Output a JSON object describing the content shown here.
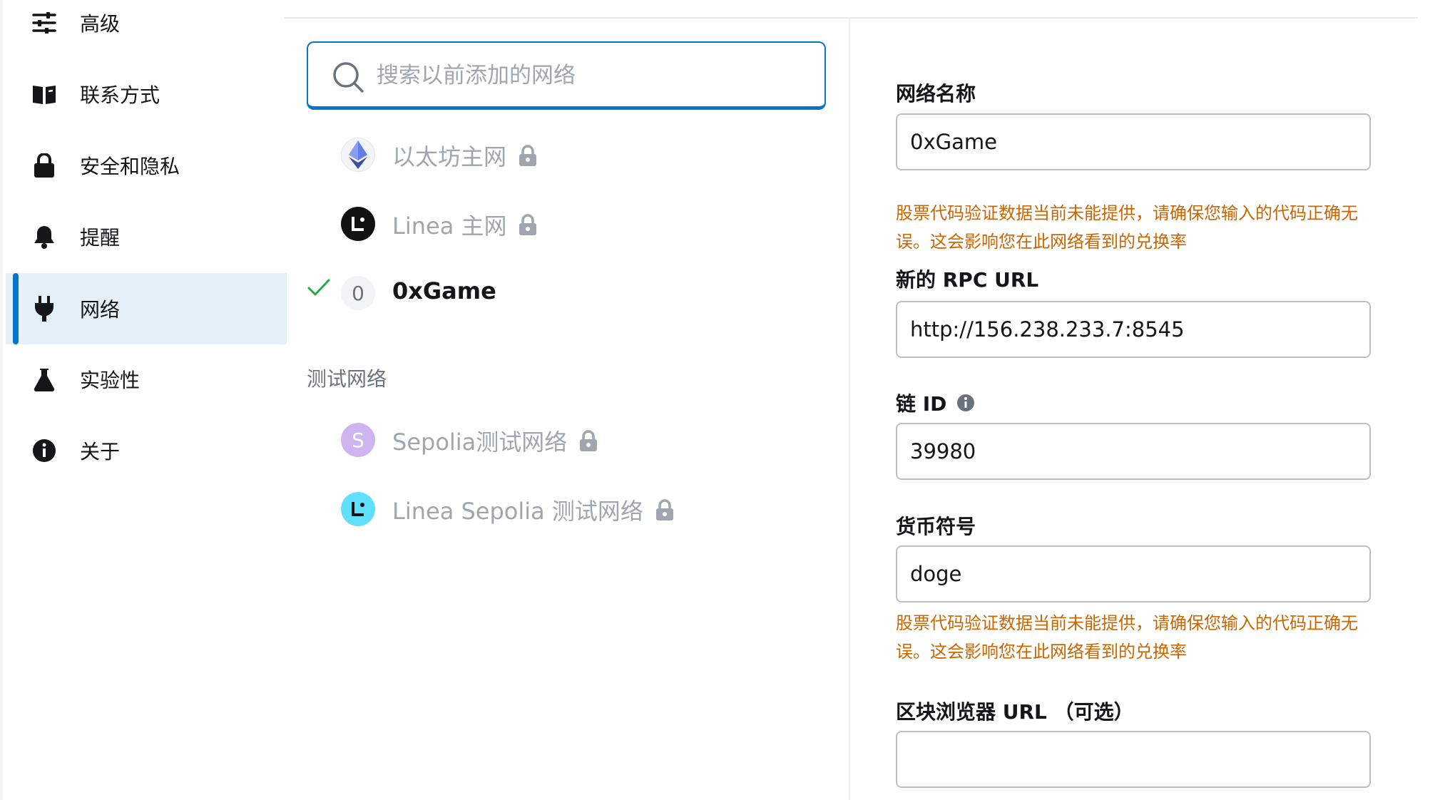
{
  "sidebar": {
    "items": [
      {
        "label": "高级",
        "icon": "sliders-icon"
      },
      {
        "label": "联系方式",
        "icon": "book-icon"
      },
      {
        "label": "安全和隐私",
        "icon": "lock-icon"
      },
      {
        "label": "提醒",
        "icon": "bell-icon"
      },
      {
        "label": "网络",
        "icon": "plug-icon",
        "active": true
      },
      {
        "label": "实验性",
        "icon": "flask-icon"
      },
      {
        "label": "关于",
        "icon": "info-icon"
      }
    ]
  },
  "search": {
    "placeholder": "搜索以前添加的网络"
  },
  "networks": [
    {
      "name": "以太坊主网",
      "avatar": "ethereum-icon",
      "locked": true
    },
    {
      "name": "Linea 主网",
      "avatar": "linea-icon",
      "locked": true
    },
    {
      "name": "0xGame",
      "avatar_letter": "0",
      "selected": true
    }
  ],
  "test_section": {
    "title": "测试网络",
    "networks": [
      {
        "name": "Sepolia测试网络",
        "avatar_letter": "S",
        "locked": true
      },
      {
        "name": "Linea Sepolia 测试网络",
        "avatar": "linea-sepolia-icon",
        "locked": true
      }
    ]
  },
  "form": {
    "network_name_label": "网络名称",
    "network_name_value": "0xGame",
    "warning_1": "股票代码验证数据当前未能提供，请确保您输入的代码正确无误。这会影响您在此网络看到的兑换率",
    "rpc_label": "新的 RPC URL",
    "rpc_value": "http://156.238.233.7:8545",
    "chain_id_label": "链 ID",
    "chain_id_value": "39980",
    "currency_label": "货币符号",
    "currency_value": "doge",
    "warning_2": "股票代码验证数据当前未能提供，请确保您输入的代码正确无误。这会影响您在此网络看到的兑换率",
    "explorer_label": "区块浏览器 URL （可选）",
    "explorer_value": ""
  },
  "colors": {
    "accent": "#0376c9",
    "warning": "#ca6500",
    "success": "#28a745",
    "muted": "#9fa6ae"
  }
}
